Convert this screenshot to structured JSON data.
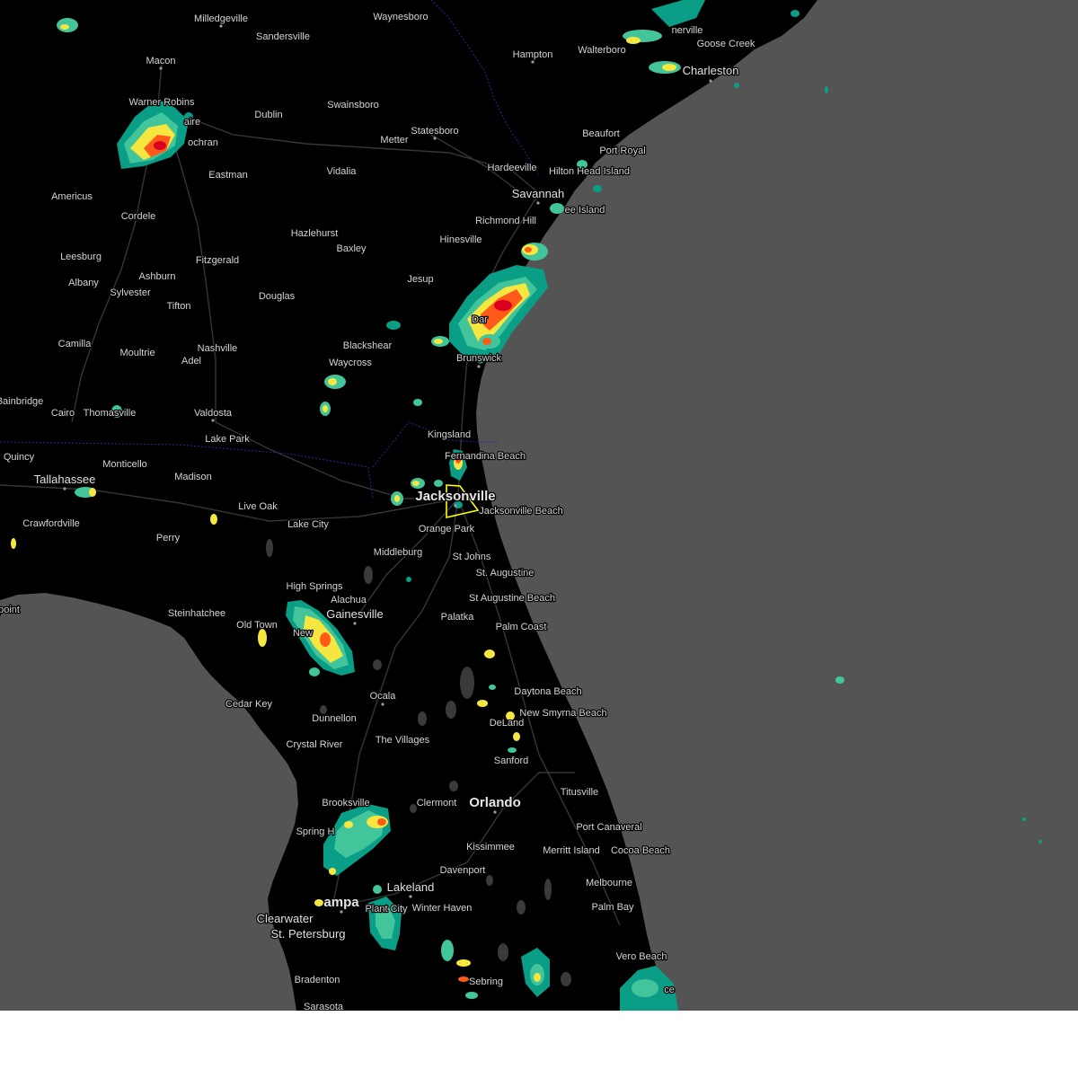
{
  "map": {
    "colors": {
      "ocean": "#545454",
      "land": "#000000",
      "lakes": "#3c3c3c",
      "roads": "#3a3a3a",
      "state_border": "#1e2a8a",
      "label": "#d4d4d4",
      "warning_polygon": "#ffff00",
      "radar_low": "#0a9e86",
      "radar_mid": "#43c59b",
      "radar_high": "#f6e640",
      "radar_severe": "#ff5a1a",
      "radar_extreme": "#d8001e"
    },
    "labels": {
      "milledgeville": "Milledgeville",
      "waynesboro": "Waynesboro",
      "sandersville": "Sandersville",
      "macon": "Macon",
      "hampton": "Hampton",
      "walterboro": "Walterboro",
      "goose_creek": "Goose Creek",
      "summerville": "nerville",
      "charleston": "Charleston",
      "warner_robins": "Warner Robins",
      "perry_ga": "aire",
      "dublin": "Dublin",
      "swainsboro": "Swainsboro",
      "statesboro": "Statesboro",
      "metter": "Metter",
      "cochran": "ochran",
      "beaufort": "Beaufort",
      "port_royal": "Port Royal",
      "hilton_head": "Hilton Head Island",
      "hardeeville": "Hardeeville",
      "eastman": "Eastman",
      "vidalia": "Vidalia",
      "savannah": "Savannah",
      "americus": "Americus",
      "cordele": "Cordele",
      "tybee": "ee Island",
      "richmond_hill": "Richmond Hill",
      "hazlehurst": "Hazlehurst",
      "baxley": "Baxley",
      "hinesville": "Hinesville",
      "leesburg": "Leesburg",
      "fitzgerald": "Fitzgerald",
      "ashburn": "Ashburn",
      "albany": "Albany",
      "sylvester": "Sylvester",
      "douglas": "Douglas",
      "jesup": "Jesup",
      "tifton": "Tifton",
      "darien": "Dar",
      "camilla": "Camilla",
      "moultrie": "Moultrie",
      "nashville": "Nashville",
      "blackshear": "Blackshear",
      "adel": "Adel",
      "waycross": "Waycross",
      "brunswick": "Brunswick",
      "bainbridge": "Bainbridge",
      "cairo": "Cairo",
      "thomasville": "Thomasville",
      "valdosta": "Valdosta",
      "lake_park": "Lake Park",
      "kingsland": "Kingsland",
      "quincy": "Quincy",
      "monticello": "Monticello",
      "fernandina": "Fernandina Beach",
      "tallahassee": "Tallahassee",
      "madison": "Madison",
      "jacksonville": "Jacksonville",
      "live_oak": "Live Oak",
      "jacksonville_beach": "Jacksonville Beach",
      "crawfordville": "Crawfordville",
      "lake_city": "Lake City",
      "orange_park": "Orange Park",
      "perry_fl": "Perry",
      "middleburg": "Middleburg",
      "st_johns": "St Johns",
      "st_augustine": "St. Augustine",
      "high_springs": "High Springs",
      "alachua": "Alachua",
      "st_augustine_beach": "St Augustine Beach",
      "steinhatchee": "Steinhatchee",
      "gainesville": "Gainesville",
      "palatka": "Palatka",
      "old_town": "Old Town",
      "palm_coast": "Palm Coast",
      "newberry": "New",
      "point": "point",
      "daytona": "Daytona Beach",
      "ocala": "Ocala",
      "cedar_key": "Cedar Key",
      "new_smyrna": "New Smyrna Beach",
      "dunnellon": "Dunnellon",
      "deland": "DeLand",
      "crystal_river": "Crystal River",
      "the_villages": "The Villages",
      "sanford": "Sanford",
      "brooksville": "Brooksville",
      "clermont": "Clermont",
      "orlando": "Orlando",
      "titusville": "Titusville",
      "spring_hill": "Spring H",
      "port_canaveral": "Port Canaveral",
      "kissimmee": "Kissimmee",
      "merritt_island": "Merritt Island",
      "cocoa_beach": "Cocoa Beach",
      "davenport": "Davenport",
      "melbourne": "Melbourne",
      "lakeland": "Lakeland",
      "tampa": "ampa",
      "plant_city": "Plant City",
      "winter_haven": "Winter Haven",
      "palm_bay": "Palm Bay",
      "clearwater": "Clearwater",
      "st_petersburg": "St. Petersburg",
      "vero_beach": "Vero Beach",
      "sebring": "Sebring",
      "bradenton": "Bradenton",
      "fort_pierce": "ce",
      "sarasota": "Sarasota"
    }
  }
}
